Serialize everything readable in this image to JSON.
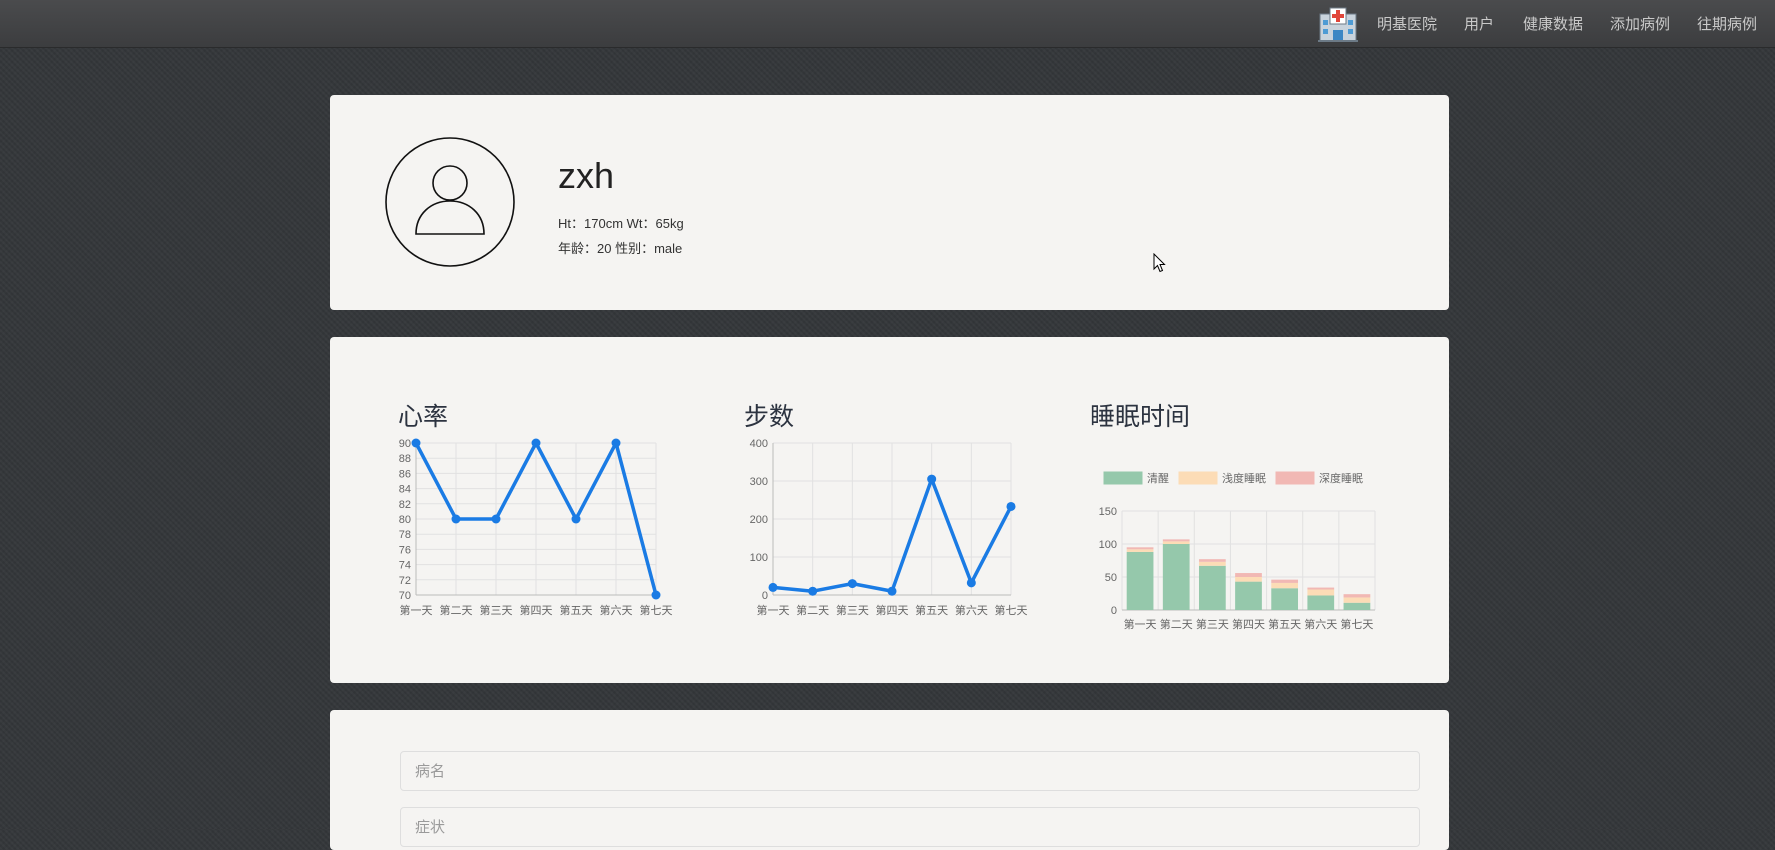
{
  "nav": {
    "brand_icon": "hospital-icon",
    "items": [
      "明基医院",
      "用户",
      "健康数据",
      "添加病例",
      "往期病例"
    ]
  },
  "profile": {
    "avatar_icon": "user-avatar-icon",
    "name": "zxh",
    "line1": "Ht：170cm Wt：65kg",
    "line2": "年龄：20 性别：male"
  },
  "charts": {
    "heart": {
      "title": "心率"
    },
    "steps": {
      "title": "步数"
    },
    "sleep": {
      "title": "睡眠时间"
    }
  },
  "chart_data": [
    {
      "type": "line",
      "title": "心率",
      "categories": [
        "第一天",
        "第二天",
        "第三天",
        "第四天",
        "第五天",
        "第六天",
        "第七天"
      ],
      "values": [
        90,
        80,
        80,
        90,
        80,
        90,
        70
      ],
      "ylim": [
        70,
        90
      ],
      "yticks": [
        70,
        72,
        74,
        76,
        78,
        80,
        82,
        84,
        86,
        88,
        90
      ],
      "grid": true,
      "color": "#1a7be4"
    },
    {
      "type": "line",
      "title": "步数",
      "categories": [
        "第一天",
        "第二天",
        "第三天",
        "第四天",
        "第五天",
        "第六天",
        "第七天"
      ],
      "values": [
        20,
        10,
        30,
        10,
        305,
        32,
        233
      ],
      "ylim": [
        0,
        400
      ],
      "yticks": [
        0,
        100,
        200,
        300,
        400
      ],
      "grid": true,
      "color": "#1a7be4"
    },
    {
      "type": "bar",
      "stacked": true,
      "title": "睡眠时间",
      "categories": [
        "第一天",
        "第二天",
        "第三天",
        "第四天",
        "第五天",
        "第六天",
        "第七天"
      ],
      "series": [
        {
          "name": "清醒",
          "values": [
            88,
            100,
            67,
            43,
            33,
            22,
            11
          ],
          "color": "#95c8ab"
        },
        {
          "name": "浅度睡眠",
          "values": [
            4,
            4,
            6,
            7,
            8,
            9,
            8
          ],
          "color": "#fcdcb6"
        },
        {
          "name": "深度睡眠",
          "values": [
            3,
            3,
            4,
            6,
            5,
            3,
            5
          ],
          "color": "#f1b8b4"
        }
      ],
      "ylim": [
        0,
        150
      ],
      "yticks": [
        0,
        50,
        100,
        150
      ],
      "legend": "top",
      "grid": true
    }
  ],
  "form": {
    "disease_placeholder": "病名",
    "symptom_placeholder": "症状"
  }
}
